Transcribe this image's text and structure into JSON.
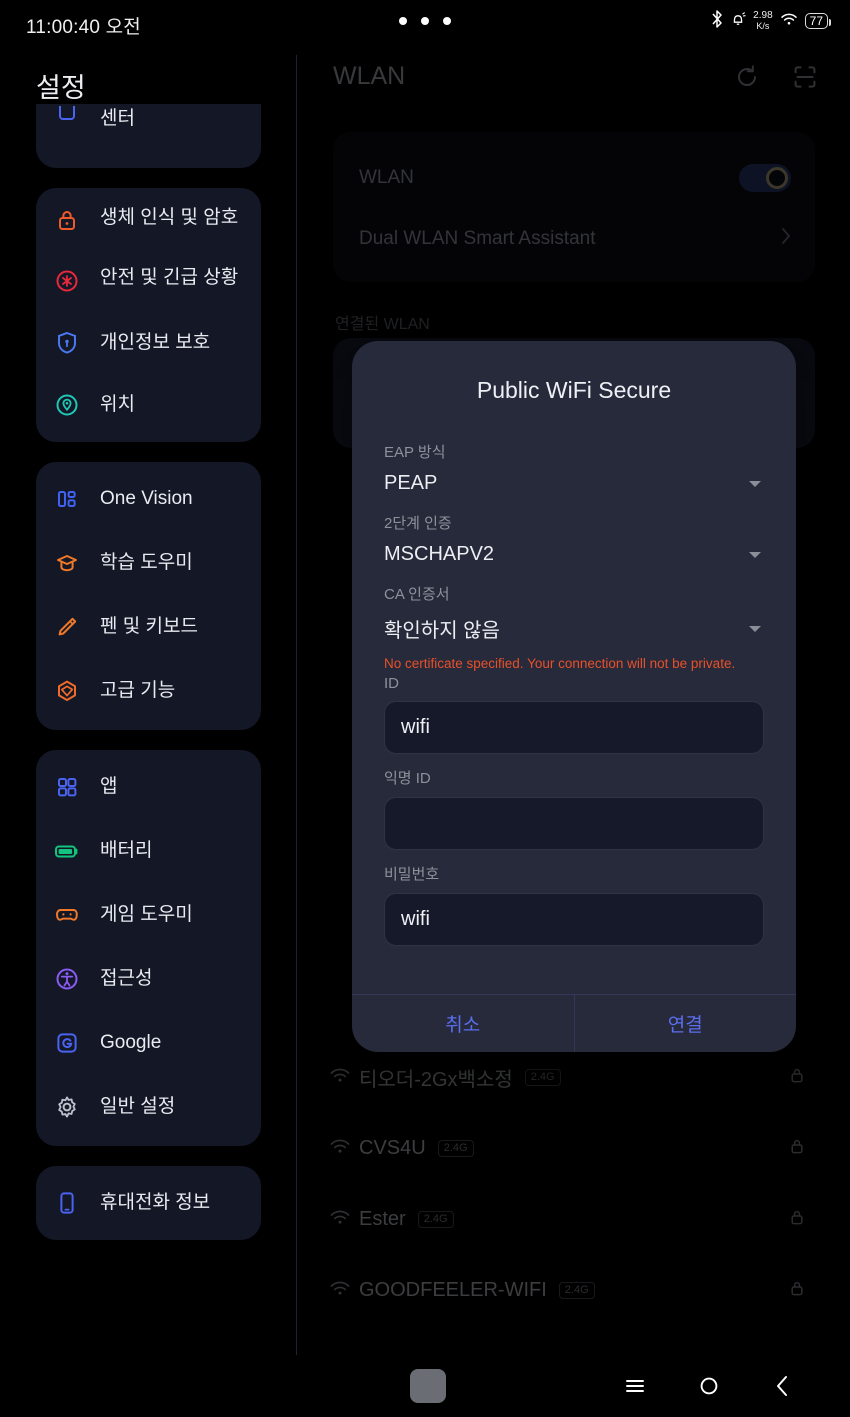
{
  "statusbar": {
    "time": "11:00:40 오전",
    "bluetooth_icon": "bluetooth-icon",
    "bell_icon": "bell-silent-icon",
    "net_speed_value": "2.98",
    "net_speed_unit": "K/s",
    "wifi_icon": "wifi-icon",
    "battery_level": "77"
  },
  "sidebar": {
    "title": "설정",
    "groups": [
      {
        "clipped": true,
        "items": [
          {
            "label": "센터",
            "icon": "notification-panel-icon",
            "color": "#4a63f0"
          }
        ]
      },
      {
        "clipped": false,
        "items": [
          {
            "label": "생체 인식 및 암호",
            "icon": "lock-icon",
            "color": "#f05a28"
          },
          {
            "label": "안전 및 긴급 상황",
            "icon": "emergency-icon",
            "color": "#e8293c"
          },
          {
            "label": "개인정보 보호",
            "icon": "shield-icon",
            "color": "#4a78f0"
          },
          {
            "label": "위치",
            "icon": "location-pin-icon",
            "color": "#1fc8b4"
          }
        ]
      },
      {
        "clipped": false,
        "items": [
          {
            "label": "One Vision",
            "icon": "one-vision-icon",
            "color": "#3f62f5"
          },
          {
            "label": "학습 도우미",
            "icon": "graduation-cap-icon",
            "color": "#f07828"
          },
          {
            "label": "펜 및 키보드",
            "icon": "pencil-icon",
            "color": "#f07828"
          },
          {
            "label": "고급 기능",
            "icon": "cube-icon",
            "color": "#f06a28"
          }
        ]
      },
      {
        "clipped": false,
        "items": [
          {
            "label": "앱",
            "icon": "apps-grid-icon",
            "color": "#4a63f0"
          },
          {
            "label": "배터리",
            "icon": "battery-icon",
            "color": "#12c47e"
          },
          {
            "label": "게임 도우미",
            "icon": "gamepad-icon",
            "color": "#f07828"
          },
          {
            "label": "접근성",
            "icon": "accessibility-icon",
            "color": "#8a5cf5"
          },
          {
            "label": "Google",
            "icon": "google-icon",
            "color": "#4a63f0"
          },
          {
            "label": "일반 설정",
            "icon": "gear-icon",
            "color": "#bfc2cc"
          }
        ]
      },
      {
        "clipped": false,
        "items": [
          {
            "label": "휴대전화 정보",
            "icon": "phone-info-icon",
            "color": "#4a63f0"
          }
        ]
      }
    ]
  },
  "wlan": {
    "header_title": "WLAN",
    "refresh_icon": "refresh-icon",
    "scan_icon": "qr-scan-icon",
    "toggle_label": "WLAN",
    "toggle_on": true,
    "dual_wlan_label": "Dual WLAN Smart Assistant",
    "connected_section_label": "연결된 WLAN",
    "networks": [
      {
        "ssid": "티오더-2Gx백소정",
        "band": "2.4G",
        "secured": true
      },
      {
        "ssid": "CVS4U",
        "band": "2.4G",
        "secured": true
      },
      {
        "ssid": "Ester",
        "band": "2.4G",
        "secured": true
      },
      {
        "ssid": "GOODFEELER-WIFI",
        "band": "2.4G",
        "secured": true
      }
    ]
  },
  "dialog": {
    "title": "Public WiFi Secure",
    "eap_method_label": "EAP 방식",
    "eap_method_value": "PEAP",
    "phase2_label": "2단계 인증",
    "phase2_value": "MSCHAPV2",
    "ca_cert_label": "CA 인증서",
    "ca_cert_value": "확인하지 않음",
    "cert_warning": "No certificate specified. Your connection will not be private.",
    "identity_label": "ID",
    "identity_value": "wifi",
    "anonymous_label": "익명 ID",
    "anonymous_value": "",
    "password_label": "비밀번호",
    "password_value": "wifi",
    "cancel_label": "취소",
    "connect_label": "연결",
    "accent_color": "#5b6ef0",
    "warning_color": "#e8502a"
  },
  "navbar": {
    "recents_icon": "recents-icon",
    "home_icon": "home-circle-icon",
    "back_icon": "back-chevron-icon"
  }
}
